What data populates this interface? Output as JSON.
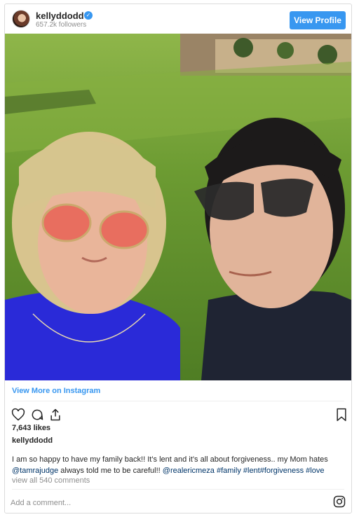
{
  "header": {
    "username": "kellyddodd",
    "followers": "657.2k followers",
    "view_profile_label": "View Profile"
  },
  "photo": {
    "subject": "selfie-two-people-sunglasses-lawn"
  },
  "actions": {
    "view_more_label": "View More on Instagram",
    "icons": [
      "heart-icon",
      "comment-icon",
      "share-icon",
      "bookmark-icon"
    ]
  },
  "likes": "7,643 likes",
  "caption": {
    "username": "kellyddodd",
    "text_part1": "I am so happy to have my family back!! It’s lent and it’s all about forgiveness.. my Mom hates",
    "mention1": "@tamrajudge",
    "text_part2": " always told me to be careful!! ",
    "mention2": "@realericmeza",
    "hashtags": " #family #lent#forgiveness #love"
  },
  "comments_link": "view all 540 comments",
  "comment_input": {
    "placeholder": "Add a comment..."
  },
  "colors": {
    "accent": "#3897f0",
    "link": "#003569",
    "muted": "#8e8e8e",
    "border": "#dbdbdb"
  }
}
